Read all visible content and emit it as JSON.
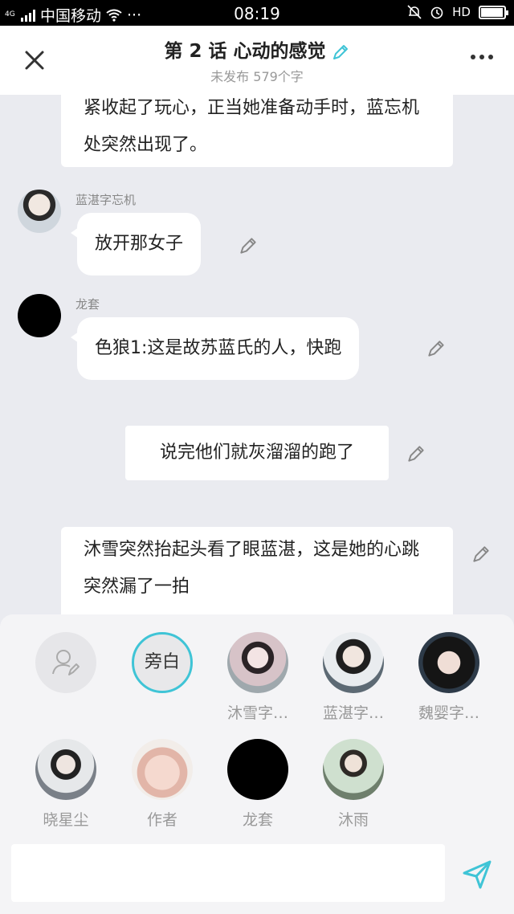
{
  "status_bar": {
    "network": "4G",
    "carrier": "中国移动",
    "dots": "···",
    "time": "08:19",
    "hd": "HD"
  },
  "header": {
    "title": "第 2 话 心动的感觉",
    "subtitle": "未发布 579个字"
  },
  "chat": {
    "narration_1": "紧收起了玩心，正当她准备动手时，蓝忘机处突然出现了。",
    "msg_1": {
      "speaker": "蓝湛字忘机",
      "text": "放开那女子"
    },
    "msg_2": {
      "speaker": "龙套",
      "text": "色狼1:这是故苏蓝氏的人，快跑"
    },
    "narration_2": "说完他们就灰溜溜的跑了",
    "narration_3": "沐雪突然抬起头看了眼蓝湛，这是她的心跳突然漏了一拍"
  },
  "characters": [
    {
      "label": "",
      "icon": "add-character-icon"
    },
    {
      "label": "旁白",
      "icon": "narrator"
    },
    {
      "label": "沐雪字…"
    },
    {
      "label": "蓝湛字…"
    },
    {
      "label": "魏婴字…"
    },
    {
      "label": "晓星尘"
    },
    {
      "label": "作者"
    },
    {
      "label": "龙套"
    },
    {
      "label": "沐雨"
    }
  ],
  "composer": {
    "value": "",
    "placeholder": ""
  },
  "colors": {
    "accent": "#3fc4d6",
    "background": "#eaebf0"
  }
}
